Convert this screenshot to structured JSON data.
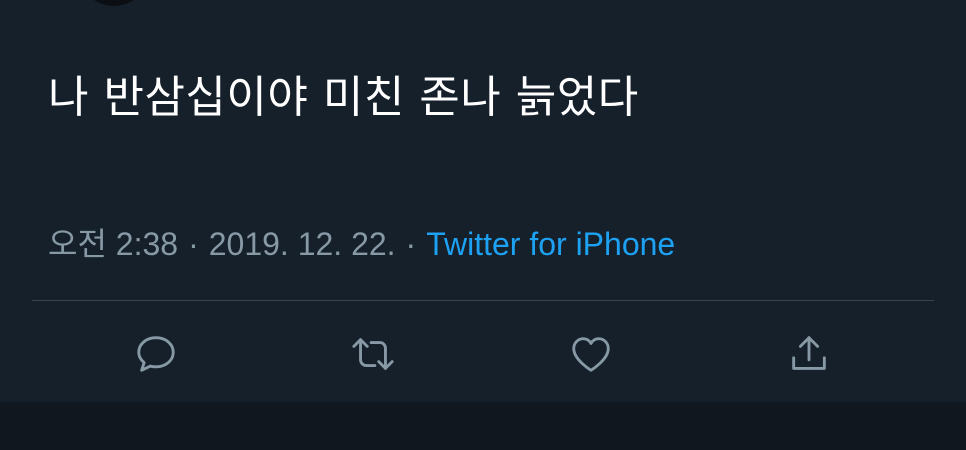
{
  "tweet": {
    "text": "나 반삼십이야 미친 존나 늙었다",
    "time": "오전 2:38",
    "date": "2019. 12. 22.",
    "source": "Twitter for iPhone",
    "separator": "·"
  },
  "actions": {
    "reply_icon": "reply-icon",
    "retweet_icon": "retweet-icon",
    "like_icon": "heart-icon",
    "share_icon": "share-icon"
  },
  "colors": {
    "background": "#15202b",
    "text": "#ffffff",
    "meta": "#8899a6",
    "link": "#1da1f2",
    "divider": "#38444d"
  }
}
